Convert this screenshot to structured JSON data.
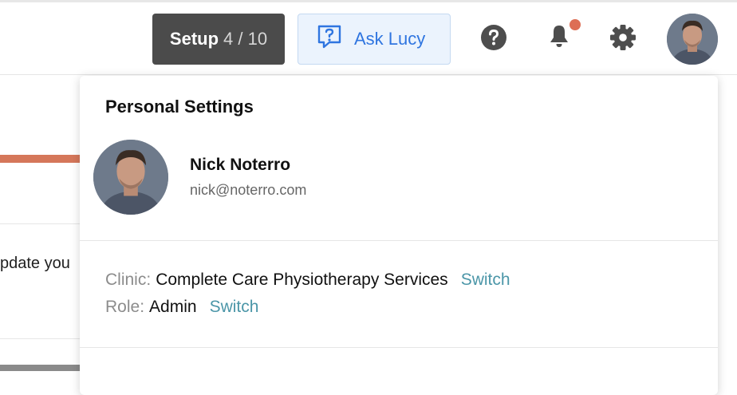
{
  "header": {
    "setup": {
      "label": "Setup",
      "progress": "4 / 10"
    },
    "ask": {
      "label": "Ask Lucy",
      "icon": "chat-question-icon"
    },
    "icons": [
      "help-icon",
      "bell-icon",
      "gear-icon"
    ],
    "notification_dot_color": "#dd6e55"
  },
  "background": {
    "partial_text": "pdate you",
    "accent_color": "#d5775a"
  },
  "panel": {
    "title": "Personal Settings",
    "user": {
      "name": "Nick Noterro",
      "email": "nick@noterro.com"
    },
    "clinic": {
      "label": "Clinic:",
      "value": "Complete Care Physiotherapy Services",
      "action": "Switch"
    },
    "role": {
      "label": "Role:",
      "value": "Admin",
      "action": "Switch"
    }
  },
  "colors": {
    "link": "#4b96a8",
    "ask_text": "#2f75e0",
    "setup_bg": "#4b4b4b"
  }
}
